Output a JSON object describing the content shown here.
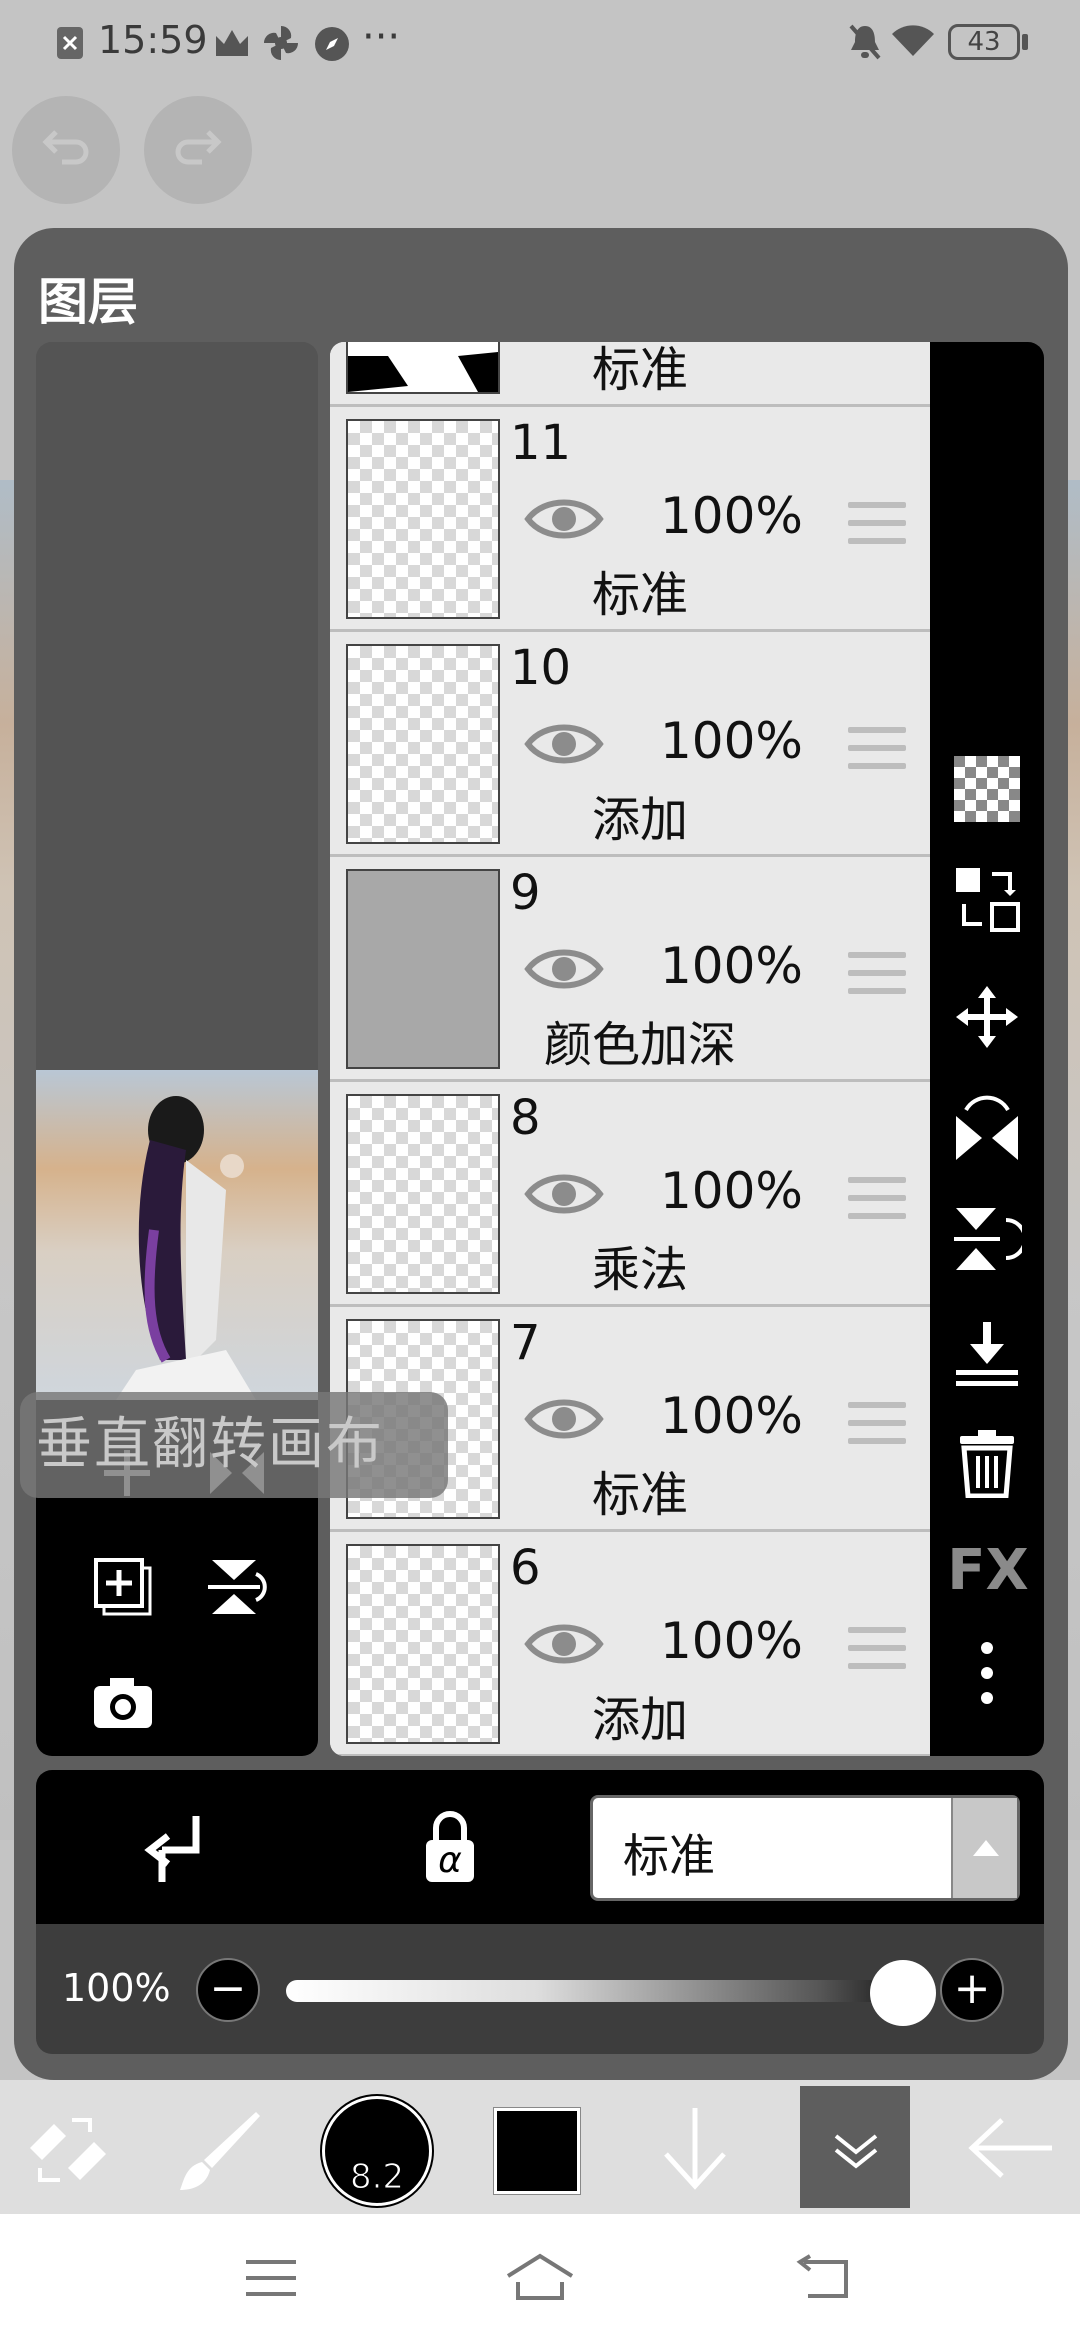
{
  "status_bar": {
    "time": "15:59",
    "battery": "43",
    "more": "···"
  },
  "panel": {
    "title": "图层",
    "toast": "垂直翻转画布"
  },
  "layers": [
    {
      "name": "top-partial",
      "number": "",
      "opacity": "",
      "mode": "标准"
    },
    {
      "number": "11",
      "opacity": "100%",
      "mode": "标准"
    },
    {
      "number": "10",
      "opacity": "100%",
      "mode": "添加"
    },
    {
      "number": "9",
      "opacity": "100%",
      "mode": "颜色加深"
    },
    {
      "number": "8",
      "opacity": "100%",
      "mode": "乘法"
    },
    {
      "number": "7",
      "opacity": "100%",
      "mode": "标准"
    },
    {
      "number": "6",
      "opacity": "100%",
      "mode": "添加"
    }
  ],
  "right_tools": {
    "fx_label": "FX"
  },
  "bottom_bar": {
    "blend_mode": "标准",
    "alpha_label": "α"
  },
  "opacity": {
    "label": "100%",
    "minus": "−",
    "plus": "+",
    "value": 1.0
  },
  "app_toolbar": {
    "brush_size": "8.2",
    "color": "#000000"
  }
}
